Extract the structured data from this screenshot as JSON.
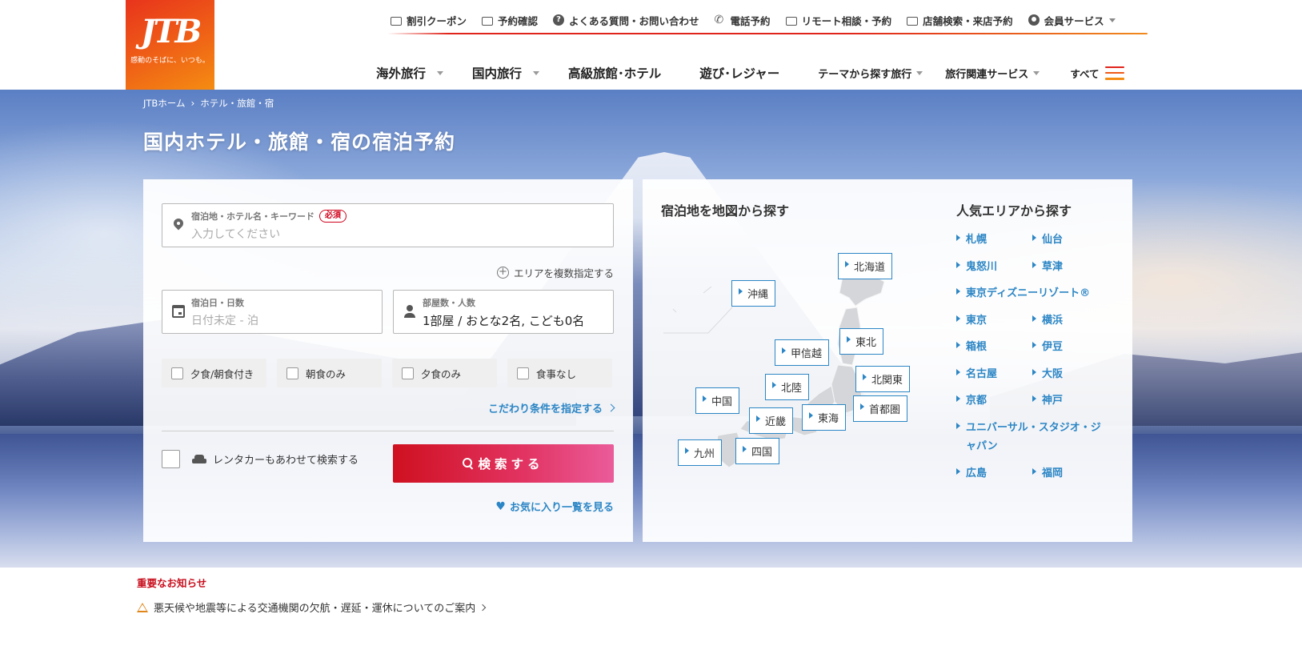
{
  "logo": {
    "brand": "JTB",
    "tagline": "感動のそばに、いつも。"
  },
  "utility_nav": [
    {
      "label": "割引クーポン",
      "icon": "coupon-icon"
    },
    {
      "label": "予約確認",
      "icon": "suitcase-icon"
    },
    {
      "label": "よくある質問・お問い合わせ",
      "icon": "question-icon"
    },
    {
      "label": "電話予約",
      "icon": "phone-icon"
    },
    {
      "label": "リモート相談・予約",
      "icon": "monitor-icon"
    },
    {
      "label": "店舗検索・来店予約",
      "icon": "building-icon"
    },
    {
      "label": "会員サービス",
      "icon": "user-icon",
      "dropdown": true
    }
  ],
  "main_nav": [
    {
      "label": "海外旅行",
      "dropdown": true
    },
    {
      "label": "国内旅行",
      "dropdown": true
    },
    {
      "label": "高級旅館･ホテル",
      "dropdown": false
    },
    {
      "label": "遊び･レジャー",
      "dropdown": false
    },
    {
      "label": "テーマから探す旅行",
      "dropdown": true
    },
    {
      "label": "旅行関連サービス",
      "dropdown": true
    }
  ],
  "nav_all_label": "すべて",
  "breadcrumb": {
    "home": "JTBホーム",
    "current": "ホテル・旅館・宿"
  },
  "page_title": "国内ホテル・旅館・宿の宿泊予約",
  "search": {
    "keyword_label": "宿泊地・ホテル名・キーワード",
    "required_badge": "必須",
    "keyword_placeholder": "入力してください",
    "area_multi": "エリアを複数指定する",
    "date_label": "宿泊日・日数",
    "date_value": "日付未定 - 泊",
    "guests_label": "部屋数・人数",
    "guests_value": "1部屋 / おとな2名, こども0名",
    "meal_options": [
      "夕食/朝食付き",
      "朝食のみ",
      "夕食のみ",
      "食事なし"
    ],
    "detail_link": "こだわり条件を指定する",
    "rentacar_label": "レンタカーもあわせて検索する",
    "search_button": "検索する",
    "favorites_link": "お気に入り一覧を見る"
  },
  "map": {
    "heading": "宿泊地を地図から探す",
    "regions": [
      "北海道",
      "沖縄",
      "東北",
      "甲信越",
      "北関東",
      "北陸",
      "中国",
      "首都圏",
      "東海",
      "近畿",
      "九州",
      "四国"
    ]
  },
  "popular": {
    "heading": "人気エリアから探す",
    "areas": [
      "札幌",
      "仙台",
      "鬼怒川",
      "草津",
      "東京ディズニーリゾート®",
      "東京",
      "横浜",
      "箱根",
      "伊豆",
      "名古屋",
      "大阪",
      "京都",
      "神戸",
      "ユニバーサル・スタジオ・ジャパン",
      "広島",
      "福岡"
    ]
  },
  "notices": {
    "heading": "重要なお知らせ",
    "items": [
      "悪天候や地震等による交通機関の欠航・遅延・運休についてのご案内"
    ]
  },
  "colors": {
    "brand_red": "#e0241b",
    "link_blue": "#2c86c5",
    "notice_red": "#c8101e"
  }
}
